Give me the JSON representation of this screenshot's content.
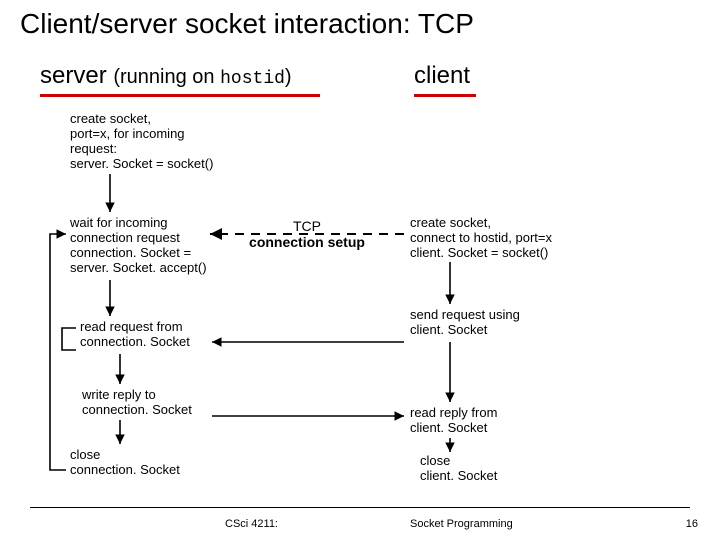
{
  "title": "Client/server socket interaction: TCP",
  "server_heading_prefix": "server ",
  "server_heading_mid": "(running on ",
  "server_heading_hostid": "hostid",
  "server_heading_suffix": ")",
  "client_heading": "client",
  "steps": {
    "s_create": "create socket,\nport=x, for incoming\nrequest:\nserver. Socket = socket()",
    "s_wait": "wait for incoming\nconnection request\nconnection. Socket =\nserver. Socket. accept()",
    "s_read": "read request from\nconnection. Socket",
    "s_write": "write reply to\nconnection. Socket",
    "s_close": "close\nconnection. Socket",
    "c_create": "create socket,\nconnect to hostid, port=x\nclient. Socket = socket()",
    "c_send": "send request using\nclient. Socket",
    "c_read": "read reply from\nclient. Socket",
    "c_close": "close\nclient. Socket"
  },
  "tcp_label_top": "TCP",
  "tcp_label_bot": "connection setup",
  "footer_course": "CSci 4211:",
  "footer_topic": "Socket Programming",
  "footer_page": "16"
}
